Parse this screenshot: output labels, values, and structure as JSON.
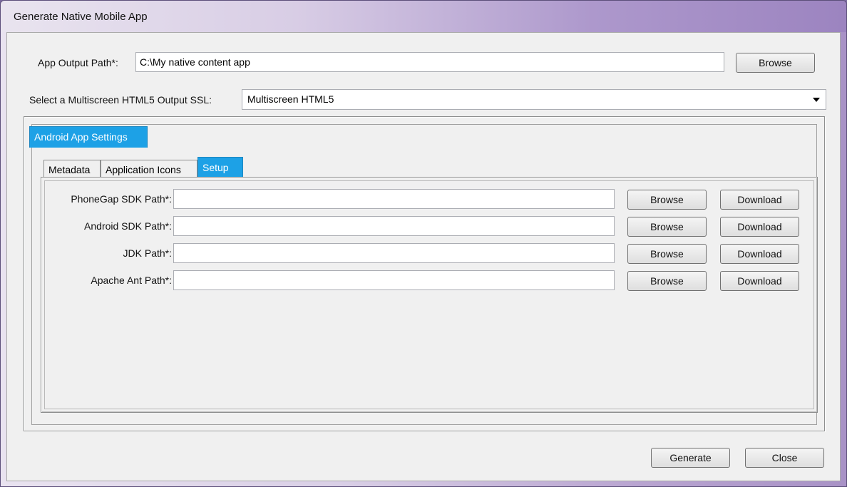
{
  "window": {
    "title": "Generate Native Mobile App"
  },
  "output": {
    "label": "App Output Path*:",
    "value": "C:\\My native content app",
    "browse_label": "Browse"
  },
  "ssl": {
    "label": "Select a Multiscreen HTML5 Output SSL:",
    "selected": "Multiscreen HTML5"
  },
  "outer_tabs": [
    {
      "label": "Android App Settings",
      "active": true
    }
  ],
  "inner_tabs": [
    {
      "label": "Metadata",
      "active": false
    },
    {
      "label": "Application Icons",
      "active": false
    },
    {
      "label": "Setup",
      "active": true
    }
  ],
  "setup": {
    "rows": [
      {
        "label": "PhoneGap SDK Path*:",
        "value": "",
        "browse": "Browse",
        "download": "Download"
      },
      {
        "label": "Android SDK Path*:",
        "value": "",
        "browse": "Browse",
        "download": "Download"
      },
      {
        "label": "JDK Path*:",
        "value": "",
        "browse": "Browse",
        "download": "Download"
      },
      {
        "label": "Apache Ant Path*:",
        "value": "",
        "browse": "Browse",
        "download": "Download"
      }
    ]
  },
  "footer": {
    "generate_label": "Generate",
    "close_label": "Close"
  }
}
